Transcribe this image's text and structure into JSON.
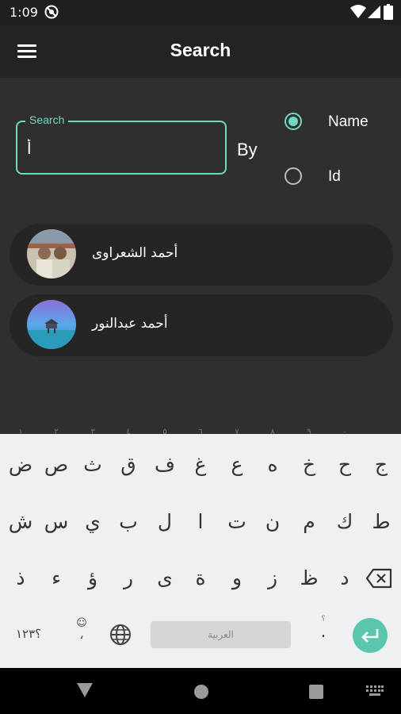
{
  "status_bar": {
    "time": "1:09",
    "icons": [
      "do-not-disturb-icon",
      "wifi-icon",
      "signal-icon",
      "battery-icon"
    ]
  },
  "app_bar": {
    "title": "Search",
    "menu_icon": "hamburger-menu-icon"
  },
  "search": {
    "label": "Search",
    "value": "أ",
    "by_label": "By"
  },
  "radio_options": [
    {
      "label": "Name",
      "selected": true
    },
    {
      "label": "Id",
      "selected": false
    }
  ],
  "results": [
    {
      "name": "أحمد الشعراوى"
    },
    {
      "name": "أحمد عبدالنور"
    }
  ],
  "keyboard": {
    "row1": [
      "ض",
      "ص",
      "ث",
      "ق",
      "ف",
      "غ",
      "ع",
      "ه",
      "خ",
      "ح",
      "ج"
    ],
    "row1_hints": [
      "١",
      "٢",
      "٣",
      "٤",
      "٥",
      "٦",
      "٧",
      "٨",
      "٩",
      "٠",
      ""
    ],
    "row2": [
      "ش",
      "س",
      "ي",
      "ب",
      "ل",
      "ا",
      "ت",
      "ن",
      "م",
      "ك",
      "ط"
    ],
    "row3": [
      "ذ",
      "ء",
      "ؤ",
      "ر",
      "ى",
      "ة",
      "و",
      "ز",
      "ظ",
      "د"
    ],
    "numbers_key": "؟١٢٣",
    "emoji_key": "☺",
    "comma_key": "،",
    "space_label": "العربية",
    "period_key": ".",
    "period_hint": "؟",
    "icons": [
      "globe-icon",
      "backspace-icon",
      "enter-icon"
    ]
  },
  "colors": {
    "accent": "#6fd9c3",
    "background": "#2f2f2f",
    "app_bar": "#232323",
    "card": "#252525",
    "keyboard": "#eef0f2",
    "enter_key": "#5bc6ae"
  }
}
